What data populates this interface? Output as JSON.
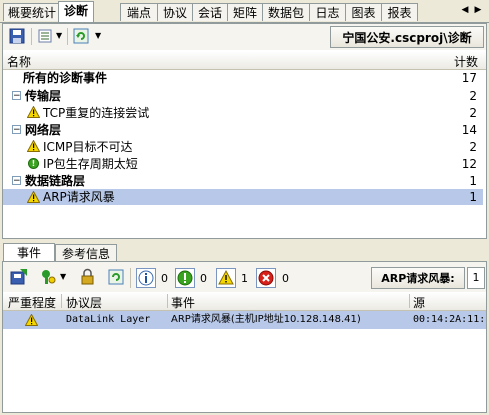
{
  "top_tabs": [
    "概要统计",
    "诊断",
    "端点",
    "协议",
    "会话",
    "矩阵",
    "数据包",
    "日志",
    "图表",
    "报表"
  ],
  "top_tabs_active": 1,
  "project_path": "宁国公安.cscproj\\诊断",
  "tree": {
    "col_name": "名称",
    "col_count": "计数",
    "rows": [
      {
        "label": "所有的诊断事件",
        "count": "17",
        "level": 0,
        "bold": true,
        "kind": "root"
      },
      {
        "label": "传输层",
        "count": "2",
        "level": 1,
        "bold": true,
        "kind": "group"
      },
      {
        "label": "TCP重复的连接尝试",
        "count": "2",
        "level": 2,
        "bold": false,
        "kind": "warn"
      },
      {
        "label": "网络层",
        "count": "14",
        "level": 1,
        "bold": true,
        "kind": "group"
      },
      {
        "label": "ICMP目标不可达",
        "count": "2",
        "level": 2,
        "bold": false,
        "kind": "warn"
      },
      {
        "label": "IP包生存周期太短",
        "count": "12",
        "level": 2,
        "bold": false,
        "kind": "ok"
      },
      {
        "label": "数据链路层",
        "count": "1",
        "level": 1,
        "bold": true,
        "kind": "group"
      },
      {
        "label": "ARP请求风暴",
        "count": "1",
        "level": 2,
        "bold": false,
        "kind": "warn",
        "selected": true
      }
    ]
  },
  "bottom_tabs": [
    "事件",
    "参考信息"
  ],
  "filters": {
    "info_count": "0",
    "ok_count": "0",
    "warn_count": "1",
    "error_count": "0"
  },
  "selected_event_label": "ARP请求风暴:",
  "selected_event_count": "1",
  "events": {
    "headers": [
      "严重程度",
      "协议层",
      "事件",
      "源"
    ],
    "rows": [
      {
        "layer": "DataLink Layer",
        "event": "ARP请求风暴(主机IP地址10.128.148.41)",
        "source": "00:14:2A:11:"
      }
    ]
  }
}
